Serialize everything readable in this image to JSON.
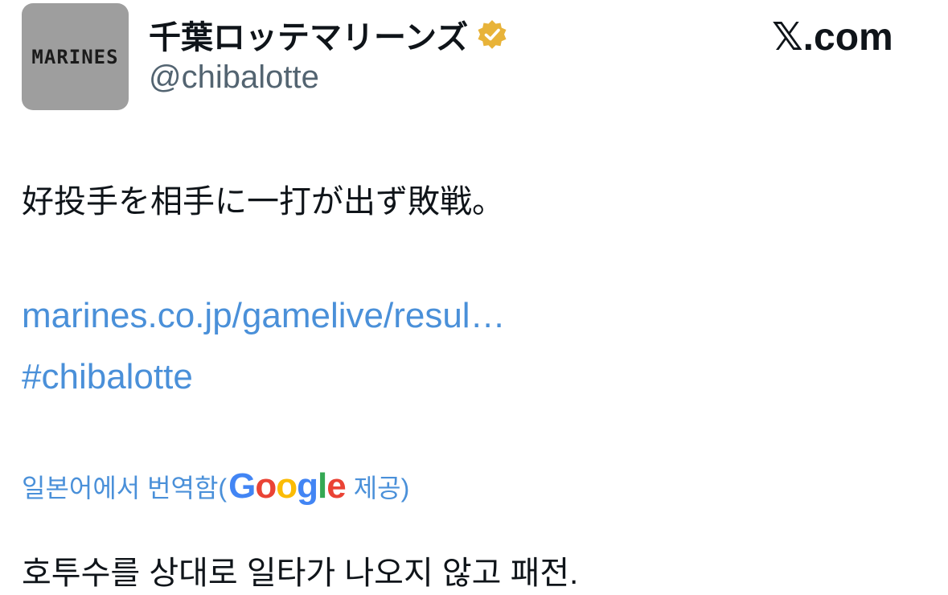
{
  "account": {
    "avatar_text": "MARINES",
    "display_name": "千葉ロッテマリーンズ",
    "handle": "@chibalotte",
    "verified_icon": "verified-badge-gold"
  },
  "brand": {
    "label": "𝕏.com"
  },
  "tweet": {
    "text": "好投手を相手に一打が出ず敗戦。",
    "link_url": "marines.co.jp/gamelive/resul…",
    "hashtag": "#chibalotte"
  },
  "translation": {
    "prefix": "일본어에서 번역함(",
    "provider_letters": [
      "G",
      "o",
      "o",
      "g",
      "l",
      "e"
    ],
    "suffix": "제공)",
    "text": "호투수를 상대로 일타가 나오지 않고 패전."
  },
  "colors": {
    "link": "#4a90d9",
    "handle": "#536471",
    "verified_gold": "#e8b339",
    "avatar_bg": "#9e9e9e"
  }
}
